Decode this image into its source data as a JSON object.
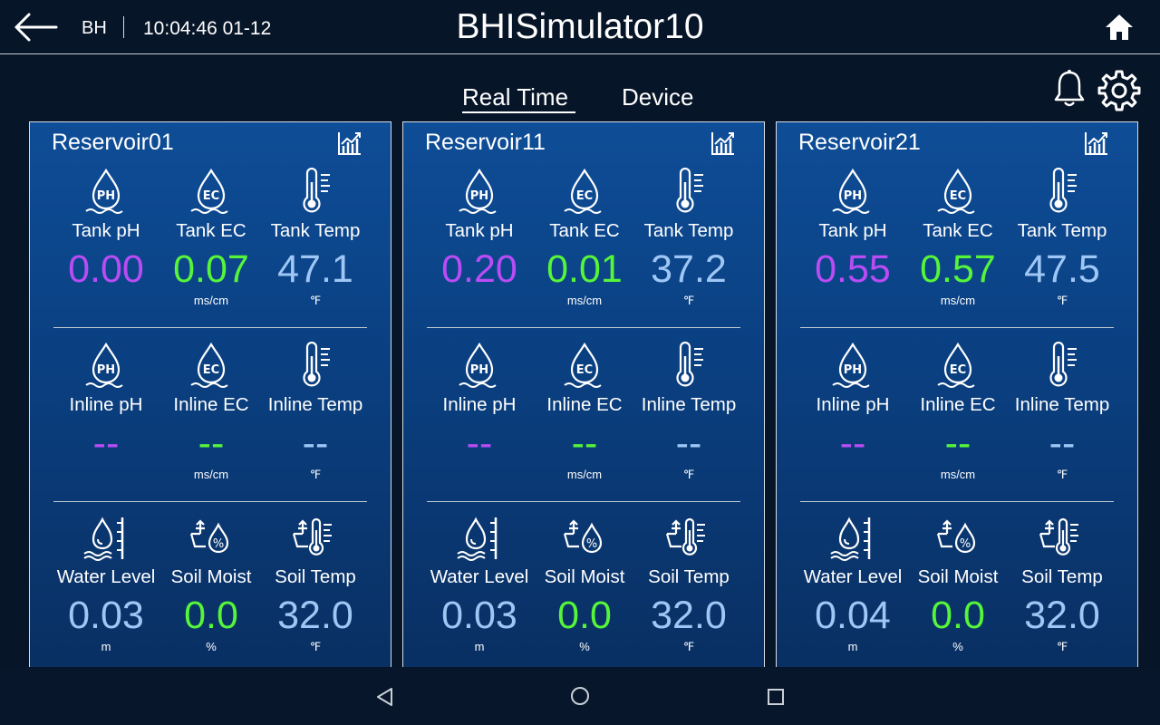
{
  "header": {
    "user": "BH",
    "datetime": "10:04:46 01-12",
    "title": "BHISimulator10"
  },
  "tabs": [
    {
      "label": "Real Time",
      "active": true
    },
    {
      "label": "Device",
      "active": false
    }
  ],
  "colors": {
    "ph": "#b94cf5",
    "ec": "#56f53a",
    "temp": "#9ec7f5",
    "water": "#9ec7f5",
    "moist": "#56f53a"
  },
  "icons": {
    "ph": "ph-drop-icon",
    "ec": "ec-drop-icon",
    "temp": "thermometer-icon",
    "water": "water-level-icon",
    "moist": "soil-moisture-icon",
    "soiltemp": "soil-temperature-icon"
  },
  "reservoirs": [
    {
      "name": "Reservoir01",
      "tank": {
        "ph_label": "Tank pH",
        "ec_label": "Tank EC",
        "temp_label": "Tank Temp",
        "ph": "0.00",
        "ec": "0.07",
        "temp": "47.1",
        "ec_unit": "ms/cm",
        "temp_unit": "℉"
      },
      "inline": {
        "ph_label": "Inline pH",
        "ec_label": "Inline EC",
        "temp_label": "Inline Temp",
        "ph": "--",
        "ec": "--",
        "temp": "--",
        "ec_unit": "ms/cm",
        "temp_unit": "℉"
      },
      "soil": {
        "water_label": "Water Level",
        "moist_label": "Soil Moist",
        "temp_label": "Soil Temp",
        "water": "0.03",
        "moist": "0.0",
        "temp": "32.0",
        "water_unit": "m",
        "moist_unit": "%",
        "temp_unit": "℉"
      }
    },
    {
      "name": "Reservoir11",
      "tank": {
        "ph_label": "Tank pH",
        "ec_label": "Tank EC",
        "temp_label": "Tank Temp",
        "ph": "0.20",
        "ec": "0.01",
        "temp": "37.2",
        "ec_unit": "ms/cm",
        "temp_unit": "℉"
      },
      "inline": {
        "ph_label": "Inline pH",
        "ec_label": "Inline EC",
        "temp_label": "Inline Temp",
        "ph": "--",
        "ec": "--",
        "temp": "--",
        "ec_unit": "ms/cm",
        "temp_unit": "℉"
      },
      "soil": {
        "water_label": "Water Level",
        "moist_label": "Soil Moist",
        "temp_label": "Soil Temp",
        "water": "0.03",
        "moist": "0.0",
        "temp": "32.0",
        "water_unit": "m",
        "moist_unit": "%",
        "temp_unit": "℉"
      }
    },
    {
      "name": "Reservoir21",
      "tank": {
        "ph_label": "Tank pH",
        "ec_label": "Tank EC",
        "temp_label": "Tank Temp",
        "ph": "0.55",
        "ec": "0.57",
        "temp": "47.5",
        "ec_unit": "ms/cm",
        "temp_unit": "℉"
      },
      "inline": {
        "ph_label": "Inline pH",
        "ec_label": "Inline EC",
        "temp_label": "Inline Temp",
        "ph": "--",
        "ec": "--",
        "temp": "--",
        "ec_unit": "ms/cm",
        "temp_unit": "℉"
      },
      "soil": {
        "water_label": "Water Level",
        "moist_label": "Soil Moist",
        "temp_label": "Soil Temp",
        "water": "0.04",
        "moist": "0.0",
        "temp": "32.0",
        "water_unit": "m",
        "moist_unit": "%",
        "temp_unit": "℉"
      }
    }
  ]
}
